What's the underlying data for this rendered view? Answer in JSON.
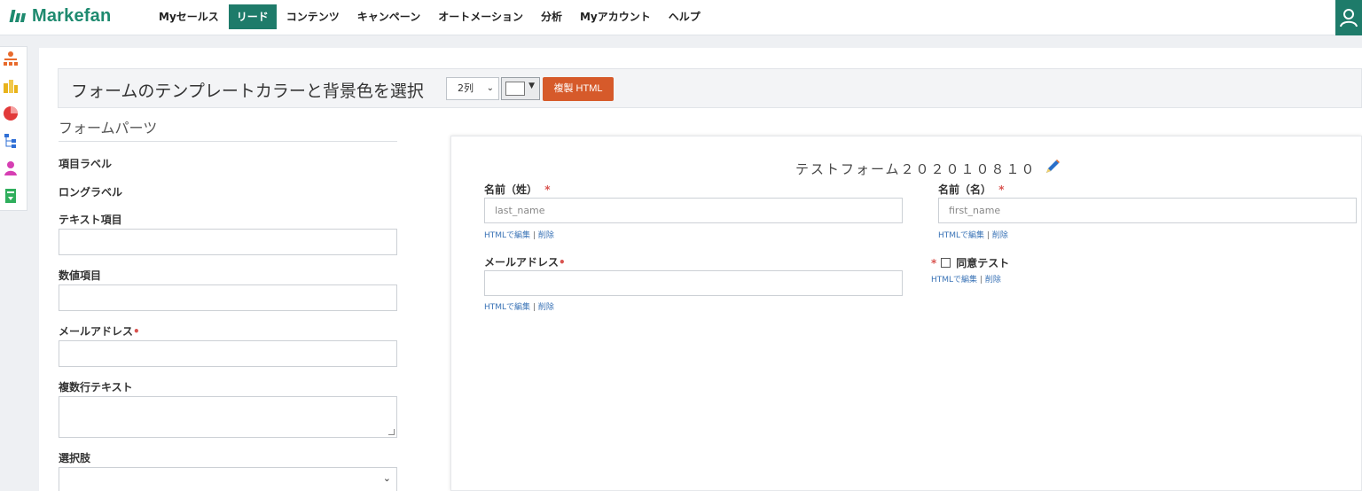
{
  "app": {
    "logo_text": "Markefan",
    "brand_color": "#1e8a6f",
    "accent_color": "#1e7b6a"
  },
  "nav": {
    "items": [
      {
        "label": "Myセールス",
        "active": false
      },
      {
        "label": "リード",
        "active": true
      },
      {
        "label": "コンテンツ",
        "active": false
      },
      {
        "label": "キャンペーン",
        "active": false
      },
      {
        "label": "オートメーション",
        "active": false
      },
      {
        "label": "分析",
        "active": false
      },
      {
        "label": "Myアカウント",
        "active": false
      },
      {
        "label": "ヘルプ",
        "active": false
      }
    ],
    "user_icon": "user-icon"
  },
  "rail": {
    "icons": [
      "hierarchy-icon",
      "buildings-icon",
      "pie-chart-icon",
      "tree-icon",
      "person-icon",
      "form-export-icon"
    ]
  },
  "toolbar": {
    "title": "フォームのテンプレートカラーと背景色を選択",
    "columns_value": "2列",
    "copy_button": "複製 HTML",
    "copy_button_color": "#d65a2a"
  },
  "parts": {
    "title": "フォームパーツ",
    "item_label": "項目ラベル",
    "long_label": "ロングラベル",
    "text_field": "テキスト項目",
    "number_field": "数値項目",
    "email_field": "メールアドレス",
    "required_mark": "•",
    "multiline_field": "複数行テキスト",
    "select_field": "選択肢"
  },
  "form": {
    "title": "テストフォーム２０２０１０８１０",
    "last_name_label": "名前（姓）",
    "last_name_placeholder": "last_name",
    "first_name_label": "名前（名）",
    "first_name_placeholder": "first_name",
    "email_label": "メールアドレス",
    "consent_label": "同意テスト",
    "required_star": "*",
    "required_dot": "•",
    "edit_html": "HTMLで編集",
    "separator": "|",
    "delete": "削除"
  }
}
